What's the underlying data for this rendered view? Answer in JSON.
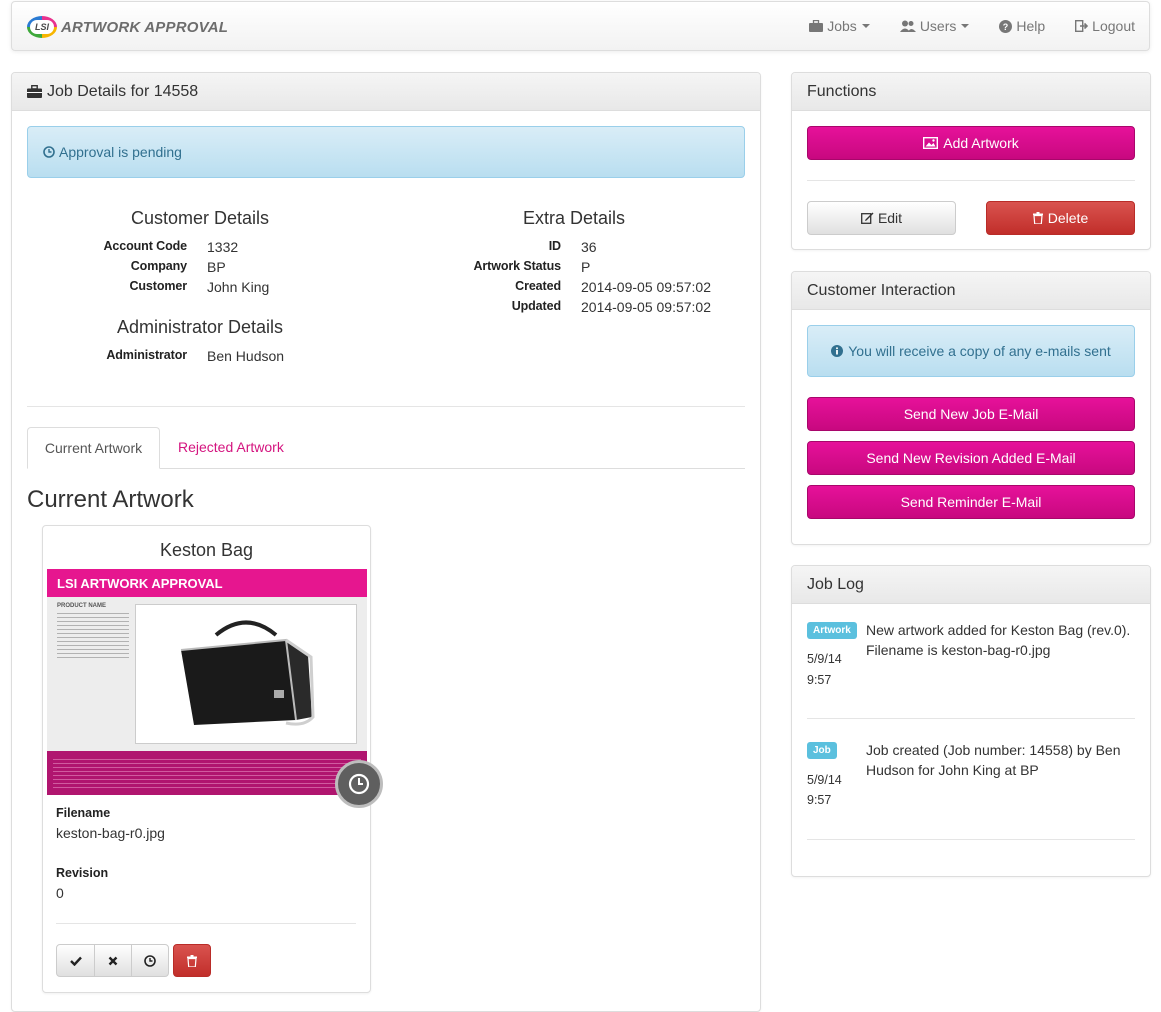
{
  "brand": {
    "logo_text": "LSI",
    "title": "ARTWORK APPROVAL"
  },
  "nav": {
    "jobs": "Jobs",
    "users": "Users",
    "help": "Help",
    "logout": "Logout"
  },
  "job": {
    "heading": "Job Details for 14558",
    "status_alert": "Approval is pending",
    "customer_details": {
      "title": "Customer Details",
      "rows": [
        {
          "label": "Account Code",
          "value": "1332"
        },
        {
          "label": "Company",
          "value": "BP"
        },
        {
          "label": "Customer",
          "value": "John King"
        }
      ]
    },
    "administrator_details": {
      "title": "Administrator Details",
      "rows": [
        {
          "label": "Administrator",
          "value": "Ben Hudson"
        }
      ]
    },
    "extra_details": {
      "title": "Extra Details",
      "rows": [
        {
          "label": "ID",
          "value": "36"
        },
        {
          "label": "Artwork Status",
          "value": "P"
        },
        {
          "label": "Created",
          "value": "2014-09-05 09:57:02"
        },
        {
          "label": "Updated",
          "value": "2014-09-05 09:57:02"
        }
      ]
    },
    "tabs": [
      {
        "label": "Current Artwork",
        "active": true
      },
      {
        "label": "Rejected Artwork",
        "active": false
      }
    ],
    "section_title": "Current Artwork",
    "artwork": {
      "name": "Keston Bag",
      "preview_header": "LSI ARTWORK APPROVAL",
      "preview_product_label": "PRODUCT NAME",
      "filename_label": "Filename",
      "filename": "keston-bag-r0.jpg",
      "revision_label": "Revision",
      "revision": "0"
    }
  },
  "functions": {
    "heading": "Functions",
    "add_artwork": "Add Artwork",
    "edit": "Edit",
    "delete": "Delete"
  },
  "customer_interaction": {
    "heading": "Customer Interaction",
    "info": "You will receive a copy of any e-mails sent",
    "send_new_job": "Send New Job E-Mail",
    "send_revision": "Send New Revision Added E-Mail",
    "send_reminder": "Send Reminder E-Mail"
  },
  "job_log": {
    "heading": "Job Log",
    "entries": [
      {
        "badge": "Artwork",
        "date": "5/9/14",
        "time": "9:57",
        "text": "New artwork added for Keston Bag (rev.0). Filename is keston-bag-r0.jpg"
      },
      {
        "badge": "Job",
        "date": "5/9/14",
        "time": "9:57",
        "text": "Job created (Job number: 14558) by Ben Hudson for John King at BP"
      }
    ]
  },
  "colors": {
    "accent_pink": "#d4147f",
    "danger": "#d9534f",
    "info": "#5bc0de"
  }
}
